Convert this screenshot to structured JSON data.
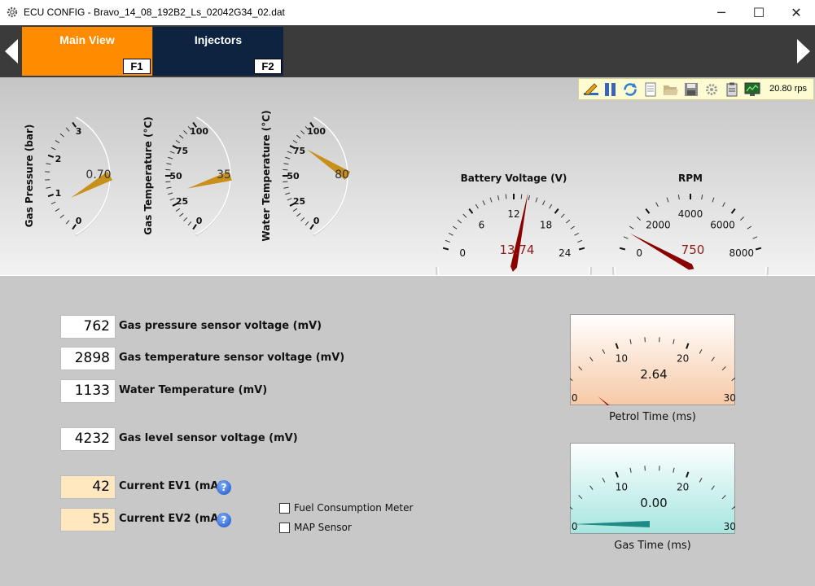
{
  "window": {
    "title": "ECU CONFIG - Bravo_14_08_192B2_Ls_02042G34_02.dat",
    "minimize": "─",
    "maximize": "☐",
    "close": "✕"
  },
  "tabs": [
    {
      "label": "Main View",
      "key": "F1",
      "active": true
    },
    {
      "label": "Injectors",
      "key": "F2",
      "active": false
    }
  ],
  "toolbar": {
    "rps": "20.80 rps"
  },
  "gauges": {
    "gas_pressure": {
      "title": "Gas Pressure (bar)",
      "value": "0.70",
      "ticks": [
        "0",
        "1",
        "2",
        "3"
      ]
    },
    "gas_temperature": {
      "title": "Gas Temperature (°C)",
      "value": "35",
      "ticks": [
        "0",
        "25",
        "50",
        "75",
        "100"
      ]
    },
    "water_temperature": {
      "title": "Water Temperature (°C)",
      "value": "80",
      "ticks": [
        "0",
        "25",
        "50",
        "75",
        "100"
      ]
    },
    "battery": {
      "title": "Battery Voltage (V)",
      "value": "13.74",
      "ticks": [
        "0",
        "6",
        "12",
        "18",
        "24"
      ]
    },
    "rpm": {
      "title": "RPM",
      "value": "750",
      "ticks": [
        "0",
        "2000",
        "4000",
        "6000",
        "8000"
      ]
    },
    "petrol_time": {
      "caption": "Petrol Time (ms)",
      "value": "2.64",
      "ticks": [
        "0",
        "10",
        "20",
        "30"
      ]
    },
    "gas_time": {
      "caption": "Gas Time (ms)",
      "value": "0.00",
      "ticks": [
        "0",
        "10",
        "20",
        "30"
      ]
    }
  },
  "readings": [
    {
      "value": "762",
      "label": "Gas pressure sensor voltage (mV)"
    },
    {
      "value": "2898",
      "label": "Gas temperature sensor voltage (mV)"
    },
    {
      "value": "1133",
      "label": "Water Temperature (mV)"
    },
    {
      "value": "4232",
      "label": "Gas level sensor voltage (mV)"
    },
    {
      "value": "42",
      "label": "Current EV1 (mA)"
    },
    {
      "value": "55",
      "label": "Current EV2 (mA)"
    }
  ],
  "options": [
    {
      "label": "Fuel Consumption Meter",
      "checked": false
    },
    {
      "label": "MAP Sensor",
      "checked": false
    }
  ],
  "help_glyph": "?",
  "colors": {
    "active_tab": "#ff8c00",
    "inactive_tab": "#0e2340",
    "needle_gold": "#c8901a",
    "needle_red": "#8b0000",
    "value_orange": "#ffe7bf"
  }
}
